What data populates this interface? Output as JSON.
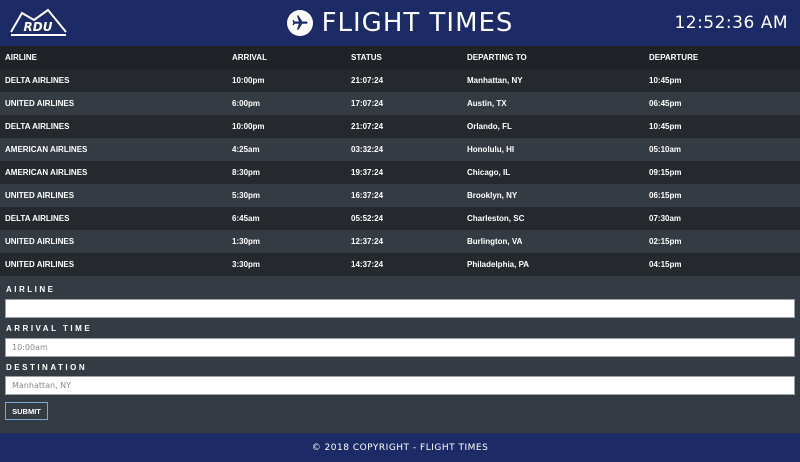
{
  "header": {
    "logo_text": "RDU",
    "title": "FLIGHT TIMES",
    "clock": "12:52:36 AM"
  },
  "table": {
    "columns": [
      "AIRLINE",
      "ARRIVAL",
      "STATUS",
      "DEPARTING TO",
      "DEPARTURE"
    ],
    "rows": [
      [
        "DELTA AIRLINES",
        "10:00pm",
        "21:07:24",
        "Manhattan, NY",
        "10:45pm"
      ],
      [
        "UNITED AIRLINES",
        "6:00pm",
        "17:07:24",
        "Austin, TX",
        "06:45pm"
      ],
      [
        "DELTA AIRLINES",
        "10:00pm",
        "21:07:24",
        "Orlando, FL",
        "10:45pm"
      ],
      [
        "AMERICAN AIRLINES",
        "4:25am",
        "03:32:24",
        "Honolulu, HI",
        "05:10am"
      ],
      [
        "AMERICAN AIRLINES",
        "8:30pm",
        "19:37:24",
        "Chicago, IL",
        "09:15pm"
      ],
      [
        "UNITED AIRLINES",
        "5:30pm",
        "16:37:24",
        "Brooklyn, NY",
        "06:15pm"
      ],
      [
        "DELTA AIRLINES",
        "6:45am",
        "05:52:24",
        "Charleston, SC",
        "07:30am"
      ],
      [
        "UNITED AIRLINES",
        "1:30pm",
        "12:37:24",
        "Burlington, VA",
        "02:15pm"
      ],
      [
        "UNITED AIRLINES",
        "3:30pm",
        "14:37:24",
        "Philadelphia, PA",
        "04:15pm"
      ]
    ]
  },
  "form": {
    "airline_label": "AIRLINE",
    "airline_value": "",
    "airline_placeholder": "",
    "arrival_label": "ARRIVAL TIME",
    "arrival_placeholder": "10:00am",
    "destination_label": "DESTINATION",
    "destination_placeholder": "Manhattan, NY",
    "submit_label": "SUBMIT"
  },
  "footer": {
    "text": "© 2018 COPYRIGHT - FLIGHT TIMES"
  },
  "colors": {
    "header_bg": "#1c2a66",
    "page_bg": "#353b42",
    "row_dark": "#25292d",
    "submit_border": "#7aa8d6"
  },
  "icons": [
    "rdu-logo-icon",
    "airplane-icon"
  ]
}
